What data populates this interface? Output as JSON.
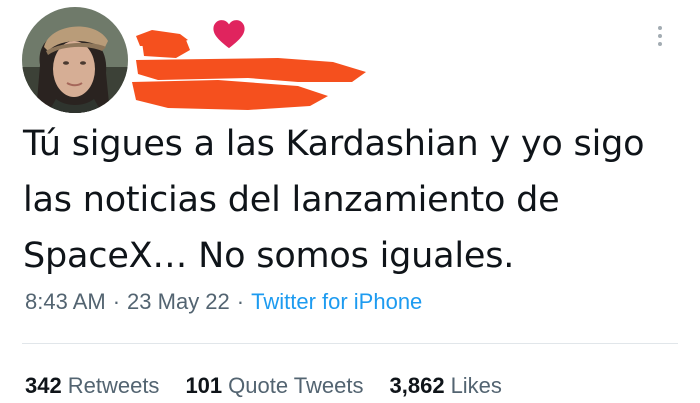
{
  "tweet": {
    "text_lines": [
      "Tú sigues a las Kardashian y yo sigo",
      "las noticias del lanzamiento de",
      "SpaceX… No somos iguales."
    ],
    "time": "8:43 AM",
    "date": "23 May 22",
    "separator": "·",
    "source": "Twitter for iPhone"
  },
  "stats": {
    "retweets": {
      "count": "342",
      "label": "Retweets"
    },
    "quote_tweets": {
      "count": "101",
      "label": "Quote Tweets"
    },
    "likes": {
      "count": "3,862",
      "label": "Likes"
    }
  },
  "icons": {
    "heart": "heart-icon",
    "more": "more-icon"
  },
  "colors": {
    "text": "#0f1419",
    "muted": "#536471",
    "link": "#1d9bf0",
    "heart": "#e0245e",
    "redaction": "#f5501e"
  }
}
